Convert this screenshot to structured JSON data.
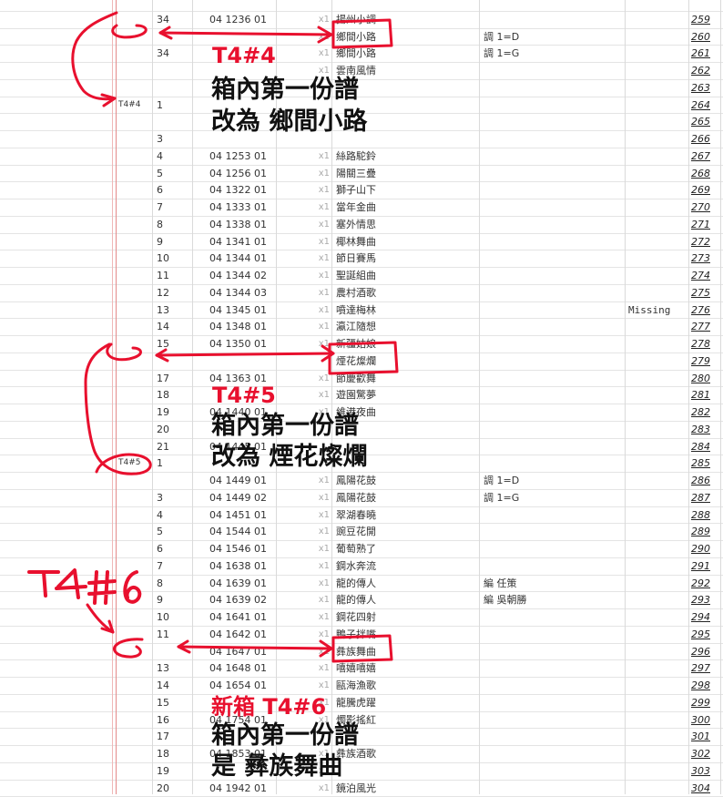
{
  "rows": [
    {
      "box": "",
      "num": "",
      "code": "",
      "x": "",
      "title": "",
      "note": "",
      "miss": "",
      "page": ""
    },
    {
      "box": "",
      "num": "34",
      "code": "04 1236 01",
      "x": "x1",
      "title": "揚州小調",
      "note": "",
      "miss": "",
      "page": "259"
    },
    {
      "box": "",
      "num": "",
      "code": "",
      "x": "x1",
      "title": "鄉間小路",
      "note": "調 1=D",
      "miss": "",
      "page": "260"
    },
    {
      "box": "",
      "num": "34",
      "code": "",
      "x": "x1",
      "title": "鄉間小路",
      "note": "調 1=G",
      "miss": "",
      "page": "261"
    },
    {
      "box": "",
      "num": "",
      "code": "",
      "x": "x1",
      "title": "雲南風情",
      "note": "",
      "miss": "",
      "page": "262"
    },
    {
      "box": "",
      "num": "",
      "code": "",
      "x": "",
      "title": "",
      "note": "",
      "miss": "",
      "page": "263"
    },
    {
      "box": "T4#4",
      "num": "1",
      "code": "",
      "x": "",
      "title": "",
      "note": "",
      "miss": "",
      "page": "264"
    },
    {
      "box": "",
      "num": "",
      "code": "",
      "x": "",
      "title": "",
      "note": "",
      "miss": "",
      "page": "265"
    },
    {
      "box": "",
      "num": "3",
      "code": "",
      "x": "",
      "title": "",
      "note": "",
      "miss": "",
      "page": "266"
    },
    {
      "box": "",
      "num": "4",
      "code": "04 1253 01",
      "x": "x1",
      "title": "絲路駝鈴",
      "note": "",
      "miss": "",
      "page": "267"
    },
    {
      "box": "",
      "num": "5",
      "code": "04 1256 01",
      "x": "x1",
      "title": "陽關三疊",
      "note": "",
      "miss": "",
      "page": "268"
    },
    {
      "box": "",
      "num": "6",
      "code": "04 1322 01",
      "x": "x1",
      "title": "獅子山下",
      "note": "",
      "miss": "",
      "page": "269"
    },
    {
      "box": "",
      "num": "7",
      "code": "04 1333 01",
      "x": "x1",
      "title": "當年金曲",
      "note": "",
      "miss": "",
      "page": "270"
    },
    {
      "box": "",
      "num": "8",
      "code": "04 1338 01",
      "x": "x1",
      "title": "塞外情思",
      "note": "",
      "miss": "",
      "page": "271"
    },
    {
      "box": "",
      "num": "9",
      "code": "04 1341 01",
      "x": "x1",
      "title": "椰林舞曲",
      "note": "",
      "miss": "",
      "page": "272"
    },
    {
      "box": "",
      "num": "10",
      "code": "04 1344 01",
      "x": "x1",
      "title": "節日賽馬",
      "note": "",
      "miss": "",
      "page": "273"
    },
    {
      "box": "",
      "num": "11",
      "code": "04 1344 02",
      "x": "x1",
      "title": "聖誕組曲",
      "note": "",
      "miss": "",
      "page": "274"
    },
    {
      "box": "",
      "num": "12",
      "code": "04 1344 03",
      "x": "x1",
      "title": "農村酒歌",
      "note": "",
      "miss": "",
      "page": "275"
    },
    {
      "box": "",
      "num": "13",
      "code": "04 1345 01",
      "x": "x1",
      "title": "噴達梅林",
      "note": "",
      "miss": "Missing",
      "page": "276"
    },
    {
      "box": "",
      "num": "14",
      "code": "04 1348 01",
      "x": "x1",
      "title": "瀛江隨想",
      "note": "",
      "miss": "",
      "page": "277"
    },
    {
      "box": "",
      "num": "15",
      "code": "04 1350 01",
      "x": "x1",
      "title": "新疆姑娘",
      "note": "",
      "miss": "",
      "page": "278"
    },
    {
      "box": "",
      "num": "",
      "code": "",
      "x": "",
      "title": "煙花燦爛",
      "note": "",
      "miss": "",
      "page": "279"
    },
    {
      "box": "",
      "num": "17",
      "code": "04 1363 01",
      "x": "x1",
      "title": "節慶歡舞",
      "note": "",
      "miss": "",
      "page": "280"
    },
    {
      "box": "",
      "num": "18",
      "code": "",
      "x": "x1",
      "title": "遊園驚夢",
      "note": "",
      "miss": "",
      "page": "281"
    },
    {
      "box": "",
      "num": "19",
      "code": "04 1440 01",
      "x": "x1",
      "title": "維港夜曲",
      "note": "",
      "miss": "",
      "page": "282"
    },
    {
      "box": "",
      "num": "20",
      "code": "",
      "x": "",
      "title": "",
      "note": "",
      "miss": "",
      "page": "283"
    },
    {
      "box": "",
      "num": "21",
      "code": "04 1445 01",
      "x": "",
      "title": "",
      "note": "",
      "miss": "",
      "page": "284"
    },
    {
      "box": "T4#5",
      "num": "1",
      "code": "",
      "x": "",
      "title": "",
      "note": "",
      "miss": "",
      "page": "285"
    },
    {
      "box": "",
      "num": "",
      "code": "04 1449 01",
      "x": "x1",
      "title": "鳳陽花鼓",
      "note": "調 1=D",
      "miss": "",
      "page": "286"
    },
    {
      "box": "",
      "num": "3",
      "code": "04 1449 02",
      "x": "x1",
      "title": "鳳陽花鼓",
      "note": "調 1=G",
      "miss": "",
      "page": "287"
    },
    {
      "box": "",
      "num": "4",
      "code": "04 1451 01",
      "x": "x1",
      "title": "翠湖春曉",
      "note": "",
      "miss": "",
      "page": "288"
    },
    {
      "box": "",
      "num": "5",
      "code": "04 1544 01",
      "x": "x1",
      "title": "豌豆花開",
      "note": "",
      "miss": "",
      "page": "289"
    },
    {
      "box": "",
      "num": "6",
      "code": "04 1546 01",
      "x": "x1",
      "title": "葡萄熟了",
      "note": "",
      "miss": "",
      "page": "290"
    },
    {
      "box": "",
      "num": "7",
      "code": "04 1638 01",
      "x": "x1",
      "title": "鋼水奔流",
      "note": "",
      "miss": "",
      "page": "291"
    },
    {
      "box": "",
      "num": "8",
      "code": "04 1639 01",
      "x": "x1",
      "title": "龍的傳人",
      "note": "編 任策",
      "miss": "",
      "page": "292"
    },
    {
      "box": "",
      "num": "9",
      "code": "04 1639 02",
      "x": "x1",
      "title": "龍的傳人",
      "note": "編 吳朝勝",
      "miss": "",
      "page": "293"
    },
    {
      "box": "",
      "num": "10",
      "code": "04 1641 01",
      "x": "x1",
      "title": "鋼花四射",
      "note": "",
      "miss": "",
      "page": "294"
    },
    {
      "box": "",
      "num": "11",
      "code": "04 1642 01",
      "x": "x1",
      "title": "鴨子拌嘴",
      "note": "",
      "miss": "",
      "page": "295"
    },
    {
      "box": "",
      "num": "",
      "code": "04 1647 01",
      "x": "x1",
      "title": "彝族舞曲",
      "note": "",
      "miss": "",
      "page": "296"
    },
    {
      "box": "",
      "num": "13",
      "code": "04 1648 01",
      "x": "x1",
      "title": "嘻嬉嘻嬉",
      "note": "",
      "miss": "",
      "page": "297"
    },
    {
      "box": "",
      "num": "14",
      "code": "04 1654 01",
      "x": "x1",
      "title": "甌海漁歌",
      "note": "",
      "miss": "",
      "page": "298"
    },
    {
      "box": "",
      "num": "15",
      "code": "",
      "x": "x1",
      "title": "龍騰虎躍",
      "note": "",
      "miss": "",
      "page": "299"
    },
    {
      "box": "",
      "num": "16",
      "code": "04 1754 01",
      "x": "x1",
      "title": "燭影搖紅",
      "note": "",
      "miss": "",
      "page": "300"
    },
    {
      "box": "",
      "num": "17",
      "code": "",
      "x": "",
      "title": "",
      "note": "",
      "miss": "",
      "page": "301"
    },
    {
      "box": "",
      "num": "18",
      "code": "04 1853 01",
      "x": "x1",
      "title": "彝族酒歌",
      "note": "",
      "miss": "",
      "page": "302"
    },
    {
      "box": "",
      "num": "19",
      "code": "",
      "x": "x1",
      "title": "",
      "note": "",
      "miss": "",
      "page": "303"
    },
    {
      "box": "",
      "num": "20",
      "code": "04 1942 01",
      "x": "x1",
      "title": "鏡泊風光",
      "note": "",
      "miss": "",
      "page": "304"
    }
  ],
  "annotations": {
    "t4_4": {
      "label": "T4#4",
      "line1": "箱內第一份譜",
      "line2": "改為 鄉間小路"
    },
    "t4_5": {
      "label": "T4#5",
      "line1": "箱內第一份譜",
      "line2": "改為 煙花燦爛"
    },
    "t4_6": {
      "label": "新箱 T4#6",
      "line1": "箱內第一份譜",
      "line2": "是 彝族舞曲"
    },
    "t4_6_handwritten": "T4#6"
  },
  "colors": {
    "annotation_red": "#e8102e",
    "annotation_black": "#111111",
    "margin_line": "#e48a8a"
  }
}
